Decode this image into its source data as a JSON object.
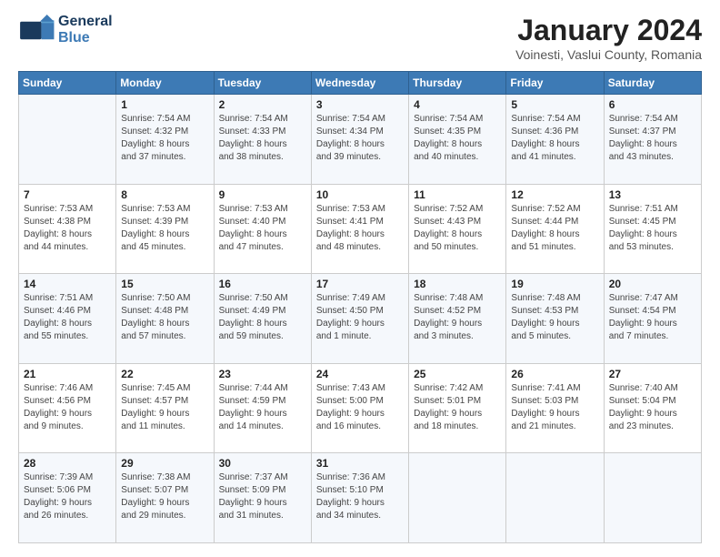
{
  "logo": {
    "line1": "General",
    "line2": "Blue"
  },
  "title": "January 2024",
  "subtitle": "Voinesti, Vaslui County, Romania",
  "header": {
    "days": [
      "Sunday",
      "Monday",
      "Tuesday",
      "Wednesday",
      "Thursday",
      "Friday",
      "Saturday"
    ]
  },
  "weeks": [
    [
      {
        "day": "",
        "info": ""
      },
      {
        "day": "1",
        "info": "Sunrise: 7:54 AM\nSunset: 4:32 PM\nDaylight: 8 hours\nand 37 minutes."
      },
      {
        "day": "2",
        "info": "Sunrise: 7:54 AM\nSunset: 4:33 PM\nDaylight: 8 hours\nand 38 minutes."
      },
      {
        "day": "3",
        "info": "Sunrise: 7:54 AM\nSunset: 4:34 PM\nDaylight: 8 hours\nand 39 minutes."
      },
      {
        "day": "4",
        "info": "Sunrise: 7:54 AM\nSunset: 4:35 PM\nDaylight: 8 hours\nand 40 minutes."
      },
      {
        "day": "5",
        "info": "Sunrise: 7:54 AM\nSunset: 4:36 PM\nDaylight: 8 hours\nand 41 minutes."
      },
      {
        "day": "6",
        "info": "Sunrise: 7:54 AM\nSunset: 4:37 PM\nDaylight: 8 hours\nand 43 minutes."
      }
    ],
    [
      {
        "day": "7",
        "info": "Sunrise: 7:53 AM\nSunset: 4:38 PM\nDaylight: 8 hours\nand 44 minutes."
      },
      {
        "day": "8",
        "info": "Sunrise: 7:53 AM\nSunset: 4:39 PM\nDaylight: 8 hours\nand 45 minutes."
      },
      {
        "day": "9",
        "info": "Sunrise: 7:53 AM\nSunset: 4:40 PM\nDaylight: 8 hours\nand 47 minutes."
      },
      {
        "day": "10",
        "info": "Sunrise: 7:53 AM\nSunset: 4:41 PM\nDaylight: 8 hours\nand 48 minutes."
      },
      {
        "day": "11",
        "info": "Sunrise: 7:52 AM\nSunset: 4:43 PM\nDaylight: 8 hours\nand 50 minutes."
      },
      {
        "day": "12",
        "info": "Sunrise: 7:52 AM\nSunset: 4:44 PM\nDaylight: 8 hours\nand 51 minutes."
      },
      {
        "day": "13",
        "info": "Sunrise: 7:51 AM\nSunset: 4:45 PM\nDaylight: 8 hours\nand 53 minutes."
      }
    ],
    [
      {
        "day": "14",
        "info": "Sunrise: 7:51 AM\nSunset: 4:46 PM\nDaylight: 8 hours\nand 55 minutes."
      },
      {
        "day": "15",
        "info": "Sunrise: 7:50 AM\nSunset: 4:48 PM\nDaylight: 8 hours\nand 57 minutes."
      },
      {
        "day": "16",
        "info": "Sunrise: 7:50 AM\nSunset: 4:49 PM\nDaylight: 8 hours\nand 59 minutes."
      },
      {
        "day": "17",
        "info": "Sunrise: 7:49 AM\nSunset: 4:50 PM\nDaylight: 9 hours\nand 1 minute."
      },
      {
        "day": "18",
        "info": "Sunrise: 7:48 AM\nSunset: 4:52 PM\nDaylight: 9 hours\nand 3 minutes."
      },
      {
        "day": "19",
        "info": "Sunrise: 7:48 AM\nSunset: 4:53 PM\nDaylight: 9 hours\nand 5 minutes."
      },
      {
        "day": "20",
        "info": "Sunrise: 7:47 AM\nSunset: 4:54 PM\nDaylight: 9 hours\nand 7 minutes."
      }
    ],
    [
      {
        "day": "21",
        "info": "Sunrise: 7:46 AM\nSunset: 4:56 PM\nDaylight: 9 hours\nand 9 minutes."
      },
      {
        "day": "22",
        "info": "Sunrise: 7:45 AM\nSunset: 4:57 PM\nDaylight: 9 hours\nand 11 minutes."
      },
      {
        "day": "23",
        "info": "Sunrise: 7:44 AM\nSunset: 4:59 PM\nDaylight: 9 hours\nand 14 minutes."
      },
      {
        "day": "24",
        "info": "Sunrise: 7:43 AM\nSunset: 5:00 PM\nDaylight: 9 hours\nand 16 minutes."
      },
      {
        "day": "25",
        "info": "Sunrise: 7:42 AM\nSunset: 5:01 PM\nDaylight: 9 hours\nand 18 minutes."
      },
      {
        "day": "26",
        "info": "Sunrise: 7:41 AM\nSunset: 5:03 PM\nDaylight: 9 hours\nand 21 minutes."
      },
      {
        "day": "27",
        "info": "Sunrise: 7:40 AM\nSunset: 5:04 PM\nDaylight: 9 hours\nand 23 minutes."
      }
    ],
    [
      {
        "day": "28",
        "info": "Sunrise: 7:39 AM\nSunset: 5:06 PM\nDaylight: 9 hours\nand 26 minutes."
      },
      {
        "day": "29",
        "info": "Sunrise: 7:38 AM\nSunset: 5:07 PM\nDaylight: 9 hours\nand 29 minutes."
      },
      {
        "day": "30",
        "info": "Sunrise: 7:37 AM\nSunset: 5:09 PM\nDaylight: 9 hours\nand 31 minutes."
      },
      {
        "day": "31",
        "info": "Sunrise: 7:36 AM\nSunset: 5:10 PM\nDaylight: 9 hours\nand 34 minutes."
      },
      {
        "day": "",
        "info": ""
      },
      {
        "day": "",
        "info": ""
      },
      {
        "day": "",
        "info": ""
      }
    ]
  ]
}
